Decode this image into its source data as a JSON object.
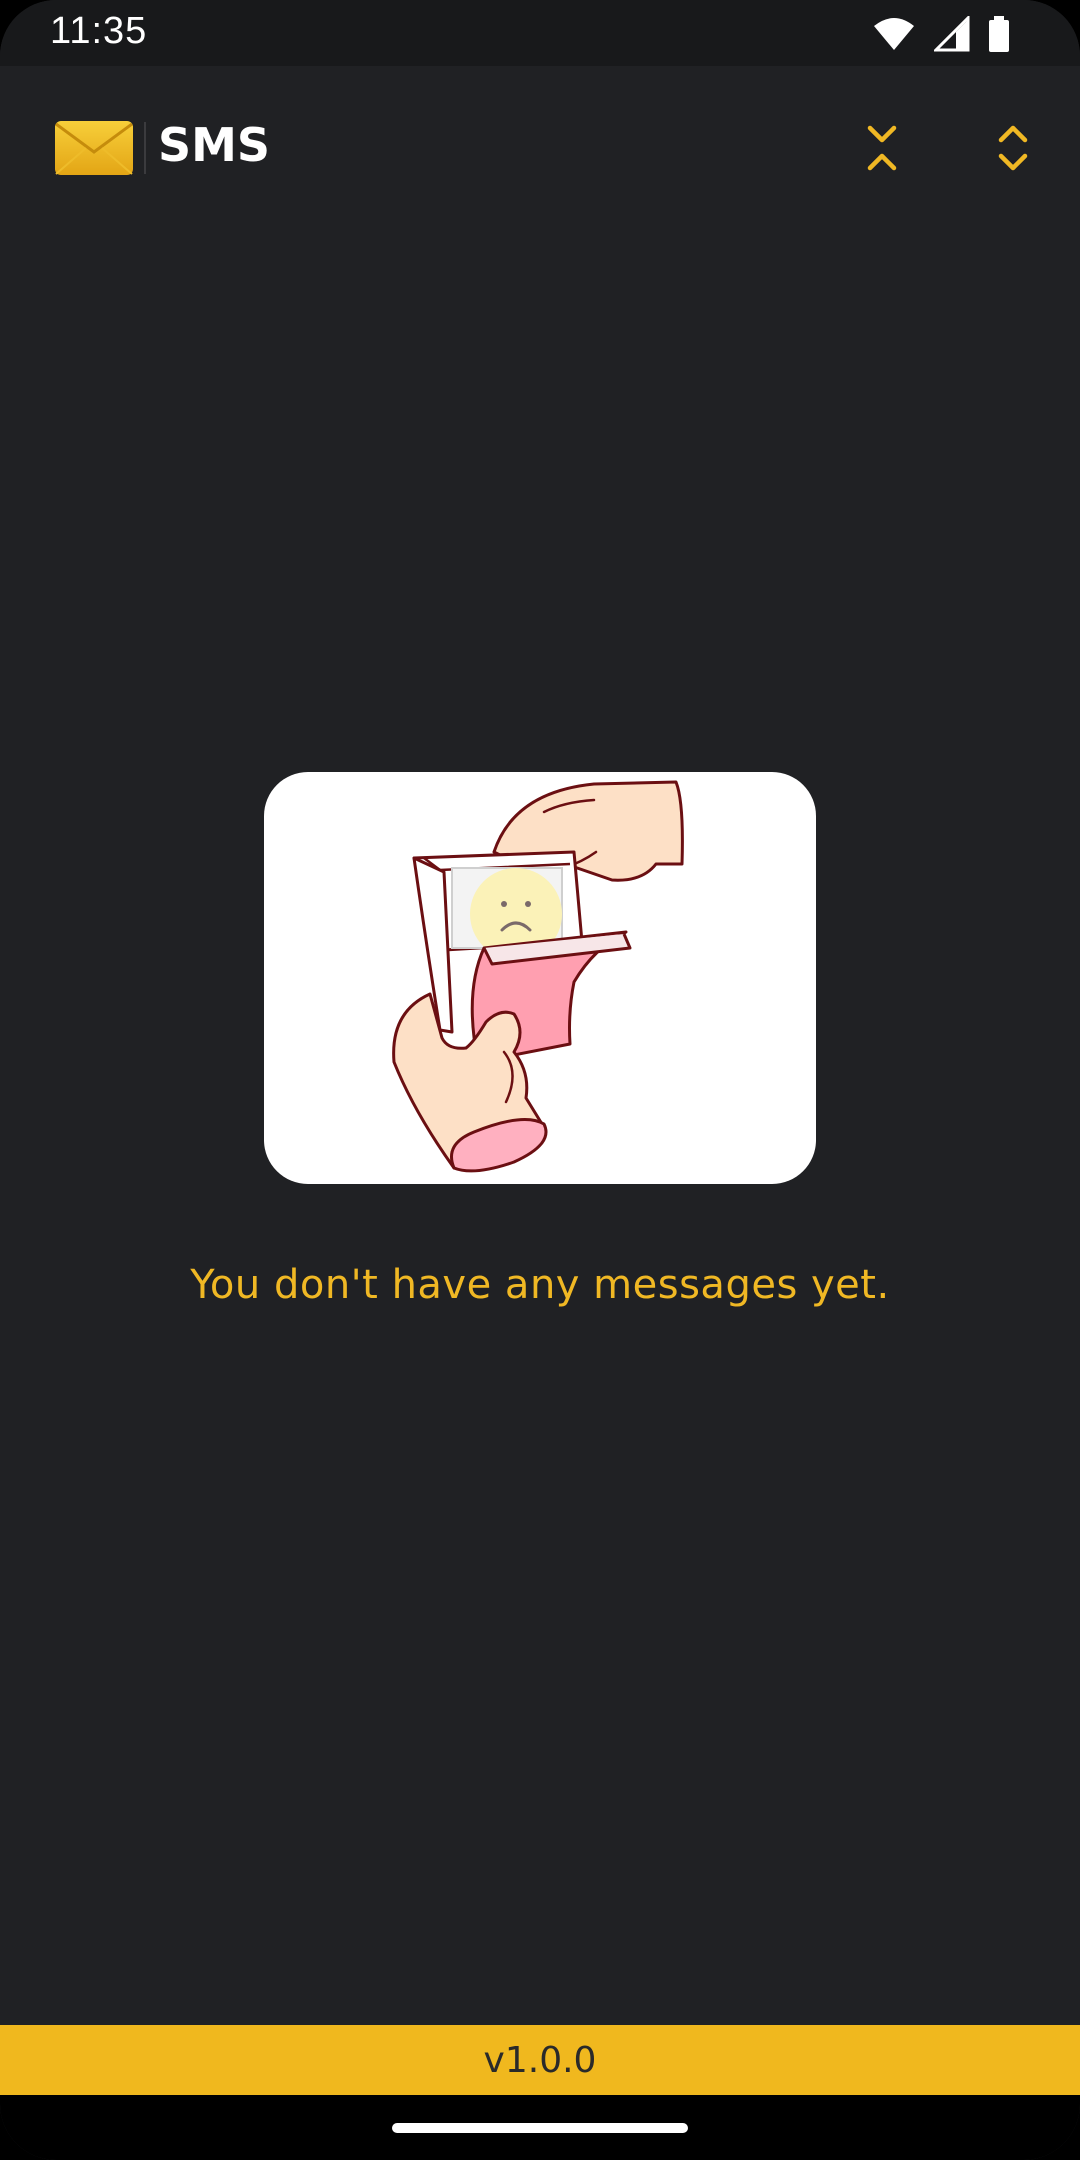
{
  "status_bar": {
    "time": "11:35",
    "icons": [
      "wifi-icon",
      "cell-signal-icon",
      "battery-icon"
    ]
  },
  "header": {
    "title": "SMS",
    "logo_icon": "envelope-icon",
    "actions": [
      "collapse-all-icon",
      "expand-all-icon"
    ]
  },
  "empty_state": {
    "illustration": "empty-envelope-sad-face-illustration",
    "message": "You don't have any messages yet."
  },
  "footer": {
    "version": "v1.0.0"
  },
  "colors": {
    "background": "#202124",
    "accent": "#f0b824",
    "footer": "#f0b81e"
  }
}
